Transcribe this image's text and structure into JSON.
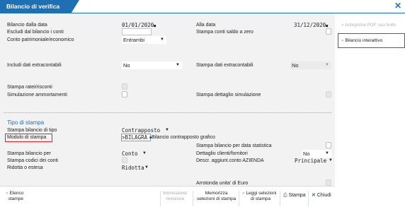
{
  "window": {
    "title": "Bilancio di verifica",
    "close_icon": "close-icon"
  },
  "fields": {
    "data_from_label": "Bilancio dalla data",
    "data_from_value": "01/01/2020",
    "data_to_label": "Alla data",
    "data_to_value": "31/12/2020",
    "escludi_label": "Escludi dal bilancio i conti",
    "stampa_saldo_zero_label": "Stampa conti saldo a zero",
    "conto_label": "Conto patrimoniale/economico",
    "conto_value": "Entrambi",
    "includi_extra_label": "Includi dati extracontabili",
    "includi_extra_value": "No",
    "stampa_extra_label": "Stampa dati extracontabili",
    "stampa_extra_value": "No",
    "ratei_label": "Stampa ratei/risconti",
    "simulazione_label": "Simulazione ammortamenti",
    "dettaglio_sim_label": "Stampa dettaglio simulazione"
  },
  "tipo_stampa": {
    "heading": "Tipo di stampa",
    "tipo_label": "Stampa bilancio di tipo",
    "tipo_value": "Contrapposto",
    "modulo_label": "Modulo di stampa",
    "modulo_code": ">BILAGRA",
    "modulo_desc": "Bilancio contrapposto grafico",
    "data_stat_label": "Stampa bilancio per data statistica",
    "per_label": "Stampa bilancio per",
    "per_value": "Conto",
    "dettaglio_cf_label": "Dettaglio clienti/fornitori",
    "dettaglio_cf_value": "No",
    "codici_label": "Stampa codici dei conti",
    "descr_label": "Descr. aggiunt.conto AZIENDA",
    "descr_value": "Principale",
    "ridotta_label": "Ridotta o estesa",
    "ridotta_value": "Ridotta",
    "arrotonda_label": "Arrotonda unita' di Euro"
  },
  "side_panel": {
    "item1": "Anteprima PDF uso bollo",
    "item2": "Bilancio interattivo"
  },
  "footer": {
    "elenco_line1": "Elenco",
    "elenco_line2": "stampe",
    "immissione_line1": "Immissione/",
    "immissione_line2": "revisione",
    "memorizza_line1": "Memorizza",
    "memorizza_line2": "selezioni di stampa",
    "leggi_line1": "Leggi selezioni",
    "leggi_line2": "di stampa",
    "stampa": "Stampa",
    "chiudi": "Chiudi"
  },
  "colors": {
    "accent": "#1f6fb3",
    "highlight": "#d9262c",
    "panel_bg": "#f2f2f2"
  }
}
